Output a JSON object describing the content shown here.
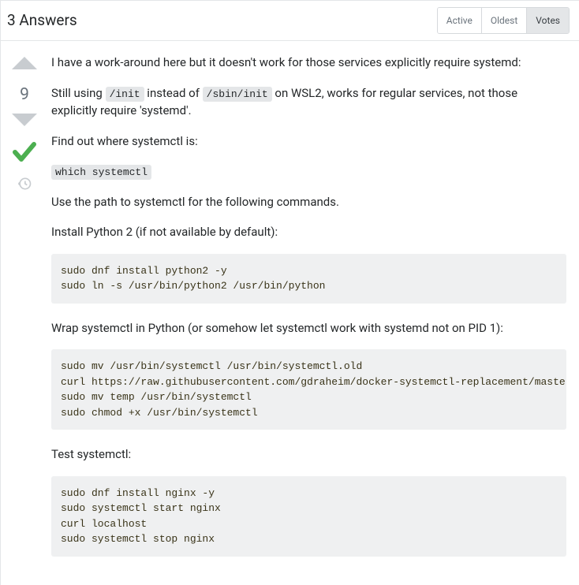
{
  "header": {
    "title": "3 Answers"
  },
  "tabs": {
    "items": [
      {
        "label": "Active",
        "active": false
      },
      {
        "label": "Oldest",
        "active": false
      },
      {
        "label": "Votes",
        "active": true
      }
    ]
  },
  "answer": {
    "score": "9",
    "p1_a": "I have a work-around here but it doesn't work for those services explicitly require systemd:",
    "p2_a": "Still using ",
    "p2_code1": "/init",
    "p2_b": " instead of ",
    "p2_code2": "/sbin/init",
    "p2_c": " on WSL2, works for regular services, not those explicitly require 'systemd'.",
    "p3": "Find out where systemctl is:",
    "code1": "which systemctl",
    "p4": "Use the path to systemctl for the following commands.",
    "p5": "Install Python 2 (if not available by default):",
    "code2": "sudo dnf install python2 -y\nsudo ln -s /usr/bin/python2 /usr/bin/python",
    "p6": "Wrap systemctl in Python (or somehow let systemctl work with systemd not on PID 1):",
    "code3": "sudo mv /usr/bin/systemctl /usr/bin/systemctl.old\ncurl https://raw.githubusercontent.com/gdraheim/docker-systemctl-replacement/master/files/docker/systemctl.py > temp\nsudo mv temp /usr/bin/systemctl\nsudo chmod +x /usr/bin/systemctl",
    "p7": "Test systemctl:",
    "code4": "sudo dnf install nginx -y\nsudo systemctl start nginx\ncurl localhost\nsudo systemctl stop nginx"
  }
}
